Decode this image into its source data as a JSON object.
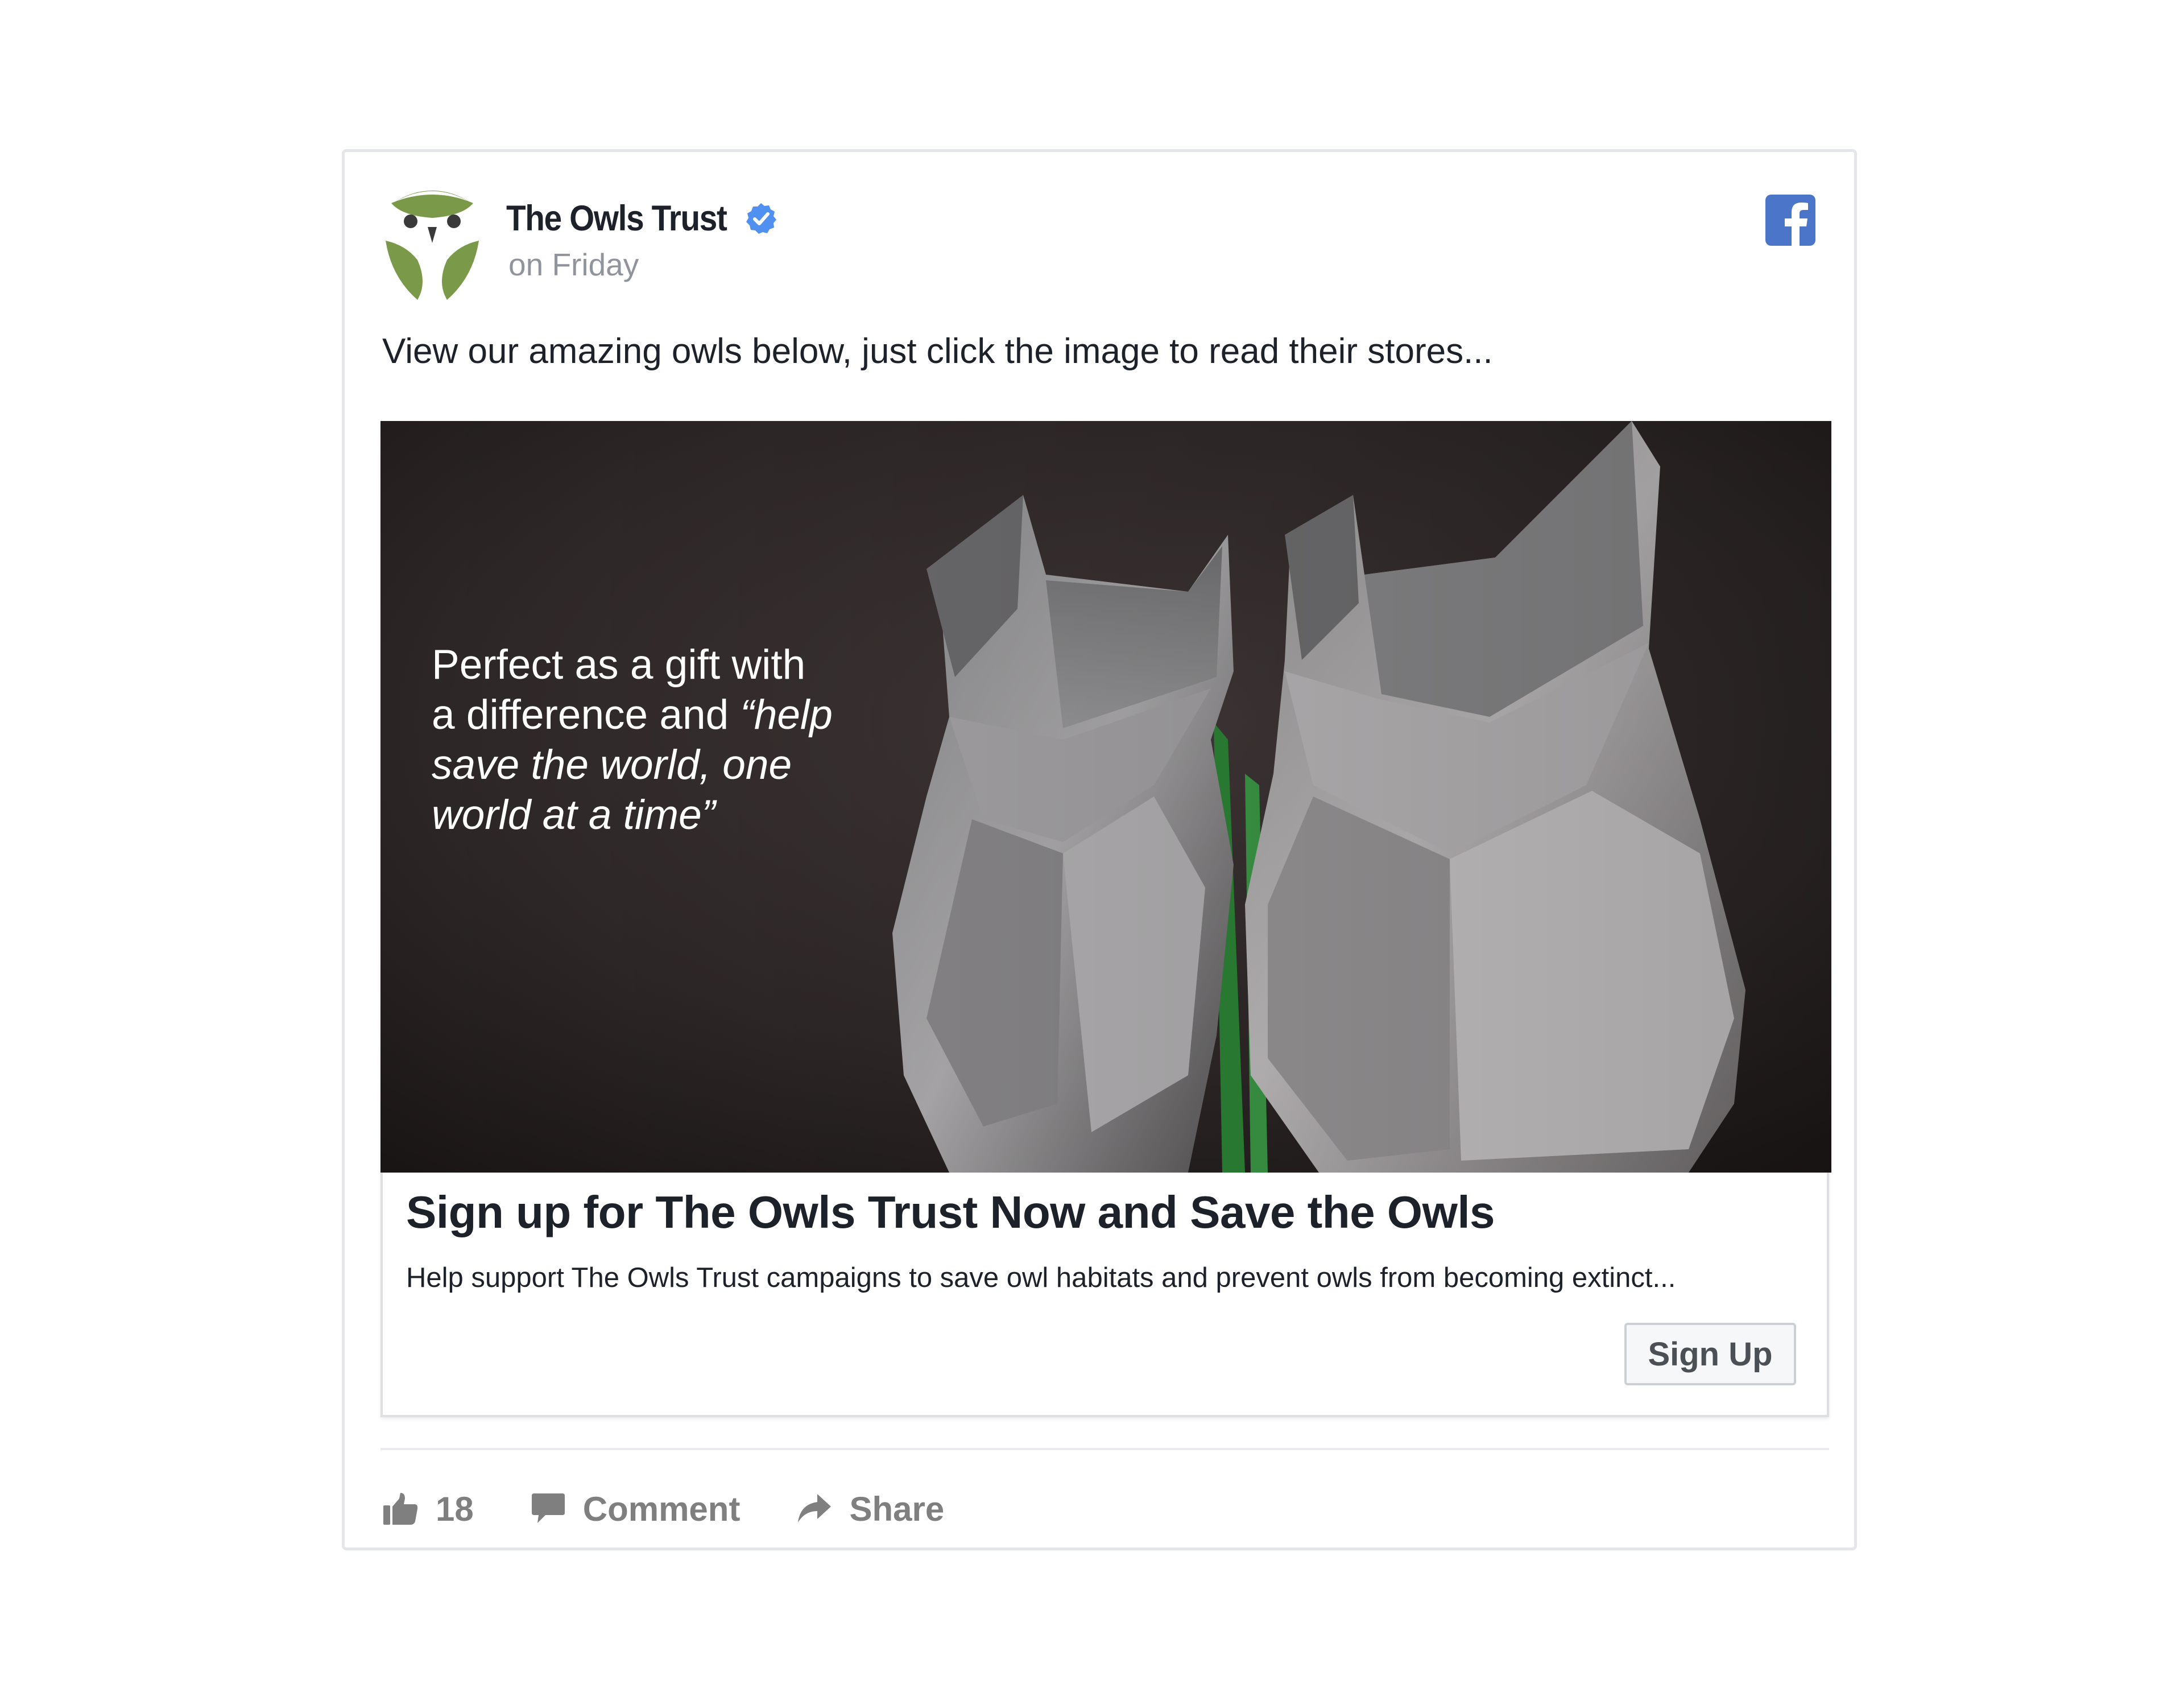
{
  "post": {
    "page_name": "The Owls Trust",
    "time": "on Friday",
    "text": "View our amazing owls below, just click the image to read their stores..."
  },
  "link_card": {
    "hero_text_line1": "Perfect as a gift with",
    "hero_text_line2_plain": "a difference and ",
    "hero_text_line2_em": "“help",
    "hero_text_line3": "save the world, one",
    "hero_text_line4": "world at a time”",
    "title": "Sign up for The Owls Trust Now and Save the Owls",
    "description": "Help support The Owls Trust campaigns to save owl habitats and prevent owls from becoming extinct...",
    "cta_label": "Sign Up"
  },
  "actions": {
    "like_count": "18",
    "comment_label": "Comment",
    "share_label": "Share"
  },
  "icons": {
    "logo": "owl-logo-icon",
    "verified": "verified-badge-icon",
    "facebook": "facebook-logo-icon",
    "like": "thumbs-up-icon",
    "comment": "comment-bubble-icon",
    "share": "share-arrow-icon"
  },
  "colors": {
    "brand_green": "#7a9a4a",
    "facebook_blue": "#4a75c8",
    "verified_blue": "#4f90f0",
    "text_dark": "#1d2129",
    "text_muted": "#90949c",
    "action_gray": "#7f7f7f"
  }
}
